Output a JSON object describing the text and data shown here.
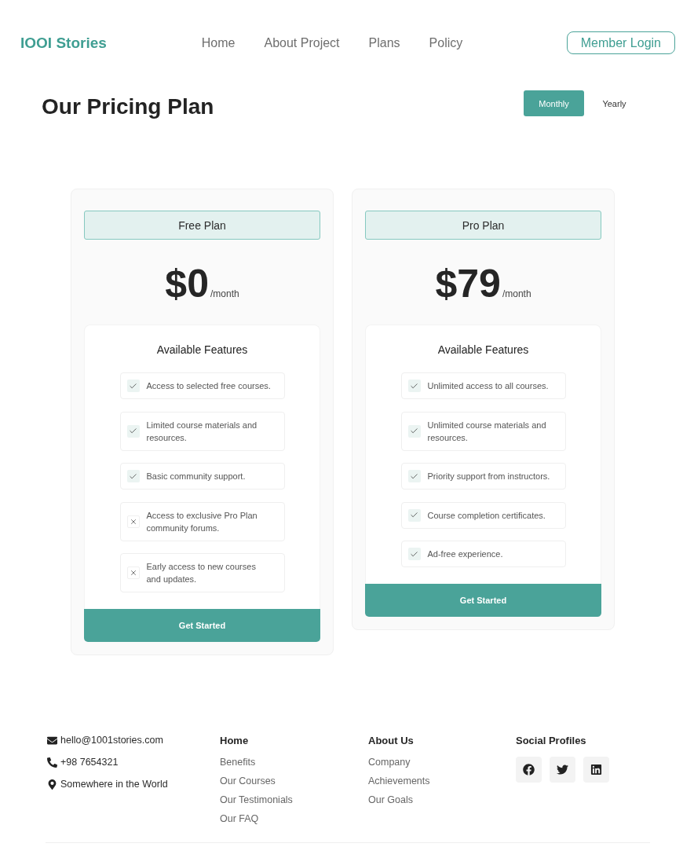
{
  "header": {
    "logo": "IOOI Stories",
    "nav": [
      {
        "label": "Home"
      },
      {
        "label": "About Project"
      },
      {
        "label": "Plans"
      },
      {
        "label": "Policy"
      }
    ],
    "login_button": "Member Login"
  },
  "title": "Our Pricing Plan",
  "billing_toggle": [
    {
      "label": "Monthly",
      "selected": true
    },
    {
      "label": "Yearly",
      "selected": false
    }
  ],
  "plans": [
    {
      "name": "Free Plan",
      "price": "$0",
      "period": "/month",
      "features_title": "Available Features",
      "features": [
        {
          "text": "Access to selected free courses.",
          "included": true
        },
        {
          "text": "Limited course materials and resources.",
          "included": true
        },
        {
          "text": "Basic community support.",
          "included": true
        },
        {
          "text": "Access to exclusive Pro Plan community forums.",
          "included": false
        },
        {
          "text": "Early access to new courses and updates.",
          "included": false
        }
      ],
      "button": "Get Started"
    },
    {
      "name": "Pro Plan",
      "price": "$79",
      "period": "/month",
      "features_title": "Available Features",
      "features": [
        {
          "text": "Unlimited access to all courses.",
          "included": true
        },
        {
          "text": "Unlimited course materials and resources.",
          "included": true
        },
        {
          "text": "Priority support from instructors.",
          "included": true
        },
        {
          "text": "Course completion certificates.",
          "included": true
        },
        {
          "text": "Ad-free experience.",
          "included": true
        }
      ],
      "button": "Get Started"
    }
  ],
  "footer": {
    "contacts": [
      {
        "kind": "email",
        "text": "hello@1001stories.com"
      },
      {
        "kind": "phone",
        "text": "+98 7654321"
      },
      {
        "kind": "location",
        "text": "Somewhere in the World"
      }
    ],
    "columns": [
      {
        "heading": "Home",
        "links": [
          "Benefits",
          "Our Courses",
          "Our Testimonials",
          "Our FAQ"
        ]
      },
      {
        "heading": "About Us",
        "links": [
          "Company",
          "Achievements",
          "Our Goals"
        ]
      }
    ],
    "social": {
      "heading": "Social Profiles",
      "profiles": [
        {
          "kind": "facebook"
        },
        {
          "kind": "twitter"
        },
        {
          "kind": "linkedin"
        }
      ]
    }
  }
}
